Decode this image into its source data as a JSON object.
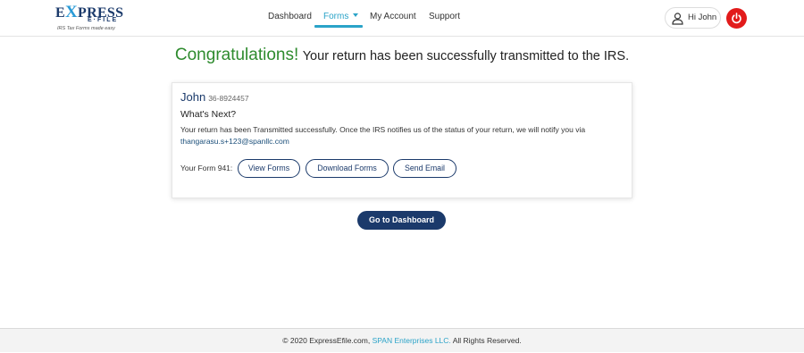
{
  "logo": {
    "main_pre": "E",
    "main_x": "X",
    "main_post": "PRESS",
    "sub": "E·FILE",
    "tagline": "IRS Tax Forms made easy"
  },
  "nav": {
    "items": [
      {
        "label": "Dashboard",
        "active": false
      },
      {
        "label": "Forms",
        "active": true,
        "dropdown": true
      },
      {
        "label": "My Account",
        "active": false
      },
      {
        "label": "Support",
        "active": false
      }
    ]
  },
  "user": {
    "greeting": "Hi John",
    "icon": "user-icon",
    "logout_icon": "power-icon"
  },
  "headline": {
    "congrats": "Congratulations!",
    "message": "Your return has been successfully transmitted to the IRS."
  },
  "card": {
    "name": "John",
    "ein": "36-8924457",
    "whats_next": "What's Next?",
    "message": "Your return has been Transmitted successfully. Once the IRS notifies us of the status of your return, we will notify you via",
    "email": "thangarasu.s+123@spanllc.com",
    "form_label": "Your Form 941:",
    "buttons": {
      "view": "View Forms",
      "download": "Download Forms",
      "email": "Send Email"
    }
  },
  "dashboard_button": "Go to Dashboard",
  "footer": {
    "prefix": "© 2020 ExpressEfile.com,",
    "link": "SPAN Enterprises LLC.",
    "suffix": "All Rights Reserved."
  },
  "colors": {
    "brand": "#1b3a6b",
    "accent": "#2aa3c8",
    "success": "#2e8b2e",
    "logout": "#e21b1b"
  }
}
